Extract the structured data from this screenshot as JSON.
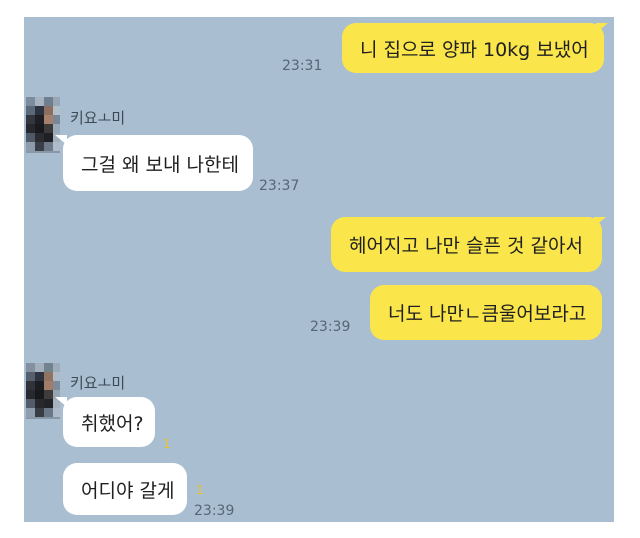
{
  "messages": [
    {
      "side": "out",
      "text": "니 집으로 양파 10kg 보냈어",
      "time": "23:31"
    },
    {
      "side": "in",
      "sender": "키요ㅗ미",
      "text": "그걸 왜 보내 나한테",
      "time": "23:37"
    },
    {
      "side": "out",
      "text": "헤어지고 나만 슬픈 것 같아서"
    },
    {
      "side": "out",
      "text": "너도 나만ㄴ큼울어보라고",
      "time": "23:39"
    },
    {
      "side": "in",
      "sender": "키요ㅗ미",
      "text": "취했어?",
      "unread": "1"
    },
    {
      "side": "in",
      "text": "어디야 갈게",
      "unread": "1",
      "time": "23:39"
    }
  ]
}
